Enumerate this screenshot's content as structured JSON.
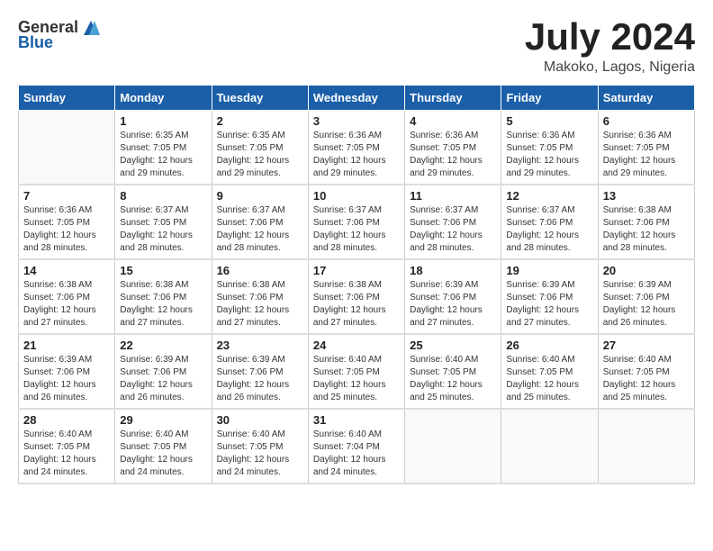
{
  "header": {
    "logo_general": "General",
    "logo_blue": "Blue",
    "month_year": "July 2024",
    "location": "Makoko, Lagos, Nigeria"
  },
  "days_of_week": [
    "Sunday",
    "Monday",
    "Tuesday",
    "Wednesday",
    "Thursday",
    "Friday",
    "Saturday"
  ],
  "weeks": [
    [
      {
        "day": "",
        "info": ""
      },
      {
        "day": "1",
        "info": "Sunrise: 6:35 AM\nSunset: 7:05 PM\nDaylight: 12 hours\nand 29 minutes."
      },
      {
        "day": "2",
        "info": "Sunrise: 6:35 AM\nSunset: 7:05 PM\nDaylight: 12 hours\nand 29 minutes."
      },
      {
        "day": "3",
        "info": "Sunrise: 6:36 AM\nSunset: 7:05 PM\nDaylight: 12 hours\nand 29 minutes."
      },
      {
        "day": "4",
        "info": "Sunrise: 6:36 AM\nSunset: 7:05 PM\nDaylight: 12 hours\nand 29 minutes."
      },
      {
        "day": "5",
        "info": "Sunrise: 6:36 AM\nSunset: 7:05 PM\nDaylight: 12 hours\nand 29 minutes."
      },
      {
        "day": "6",
        "info": "Sunrise: 6:36 AM\nSunset: 7:05 PM\nDaylight: 12 hours\nand 29 minutes."
      }
    ],
    [
      {
        "day": "7",
        "info": "Sunrise: 6:36 AM\nSunset: 7:05 PM\nDaylight: 12 hours\nand 28 minutes."
      },
      {
        "day": "8",
        "info": "Sunrise: 6:37 AM\nSunset: 7:05 PM\nDaylight: 12 hours\nand 28 minutes."
      },
      {
        "day": "9",
        "info": "Sunrise: 6:37 AM\nSunset: 7:06 PM\nDaylight: 12 hours\nand 28 minutes."
      },
      {
        "day": "10",
        "info": "Sunrise: 6:37 AM\nSunset: 7:06 PM\nDaylight: 12 hours\nand 28 minutes."
      },
      {
        "day": "11",
        "info": "Sunrise: 6:37 AM\nSunset: 7:06 PM\nDaylight: 12 hours\nand 28 minutes."
      },
      {
        "day": "12",
        "info": "Sunrise: 6:37 AM\nSunset: 7:06 PM\nDaylight: 12 hours\nand 28 minutes."
      },
      {
        "day": "13",
        "info": "Sunrise: 6:38 AM\nSunset: 7:06 PM\nDaylight: 12 hours\nand 28 minutes."
      }
    ],
    [
      {
        "day": "14",
        "info": "Sunrise: 6:38 AM\nSunset: 7:06 PM\nDaylight: 12 hours\nand 27 minutes."
      },
      {
        "day": "15",
        "info": "Sunrise: 6:38 AM\nSunset: 7:06 PM\nDaylight: 12 hours\nand 27 minutes."
      },
      {
        "day": "16",
        "info": "Sunrise: 6:38 AM\nSunset: 7:06 PM\nDaylight: 12 hours\nand 27 minutes."
      },
      {
        "day": "17",
        "info": "Sunrise: 6:38 AM\nSunset: 7:06 PM\nDaylight: 12 hours\nand 27 minutes."
      },
      {
        "day": "18",
        "info": "Sunrise: 6:39 AM\nSunset: 7:06 PM\nDaylight: 12 hours\nand 27 minutes."
      },
      {
        "day": "19",
        "info": "Sunrise: 6:39 AM\nSunset: 7:06 PM\nDaylight: 12 hours\nand 27 minutes."
      },
      {
        "day": "20",
        "info": "Sunrise: 6:39 AM\nSunset: 7:06 PM\nDaylight: 12 hours\nand 26 minutes."
      }
    ],
    [
      {
        "day": "21",
        "info": "Sunrise: 6:39 AM\nSunset: 7:06 PM\nDaylight: 12 hours\nand 26 minutes."
      },
      {
        "day": "22",
        "info": "Sunrise: 6:39 AM\nSunset: 7:06 PM\nDaylight: 12 hours\nand 26 minutes."
      },
      {
        "day": "23",
        "info": "Sunrise: 6:39 AM\nSunset: 7:06 PM\nDaylight: 12 hours\nand 26 minutes."
      },
      {
        "day": "24",
        "info": "Sunrise: 6:40 AM\nSunset: 7:05 PM\nDaylight: 12 hours\nand 25 minutes."
      },
      {
        "day": "25",
        "info": "Sunrise: 6:40 AM\nSunset: 7:05 PM\nDaylight: 12 hours\nand 25 minutes."
      },
      {
        "day": "26",
        "info": "Sunrise: 6:40 AM\nSunset: 7:05 PM\nDaylight: 12 hours\nand 25 minutes."
      },
      {
        "day": "27",
        "info": "Sunrise: 6:40 AM\nSunset: 7:05 PM\nDaylight: 12 hours\nand 25 minutes."
      }
    ],
    [
      {
        "day": "28",
        "info": "Sunrise: 6:40 AM\nSunset: 7:05 PM\nDaylight: 12 hours\nand 24 minutes."
      },
      {
        "day": "29",
        "info": "Sunrise: 6:40 AM\nSunset: 7:05 PM\nDaylight: 12 hours\nand 24 minutes."
      },
      {
        "day": "30",
        "info": "Sunrise: 6:40 AM\nSunset: 7:05 PM\nDaylight: 12 hours\nand 24 minutes."
      },
      {
        "day": "31",
        "info": "Sunrise: 6:40 AM\nSunset: 7:04 PM\nDaylight: 12 hours\nand 24 minutes."
      },
      {
        "day": "",
        "info": ""
      },
      {
        "day": "",
        "info": ""
      },
      {
        "day": "",
        "info": ""
      }
    ]
  ]
}
